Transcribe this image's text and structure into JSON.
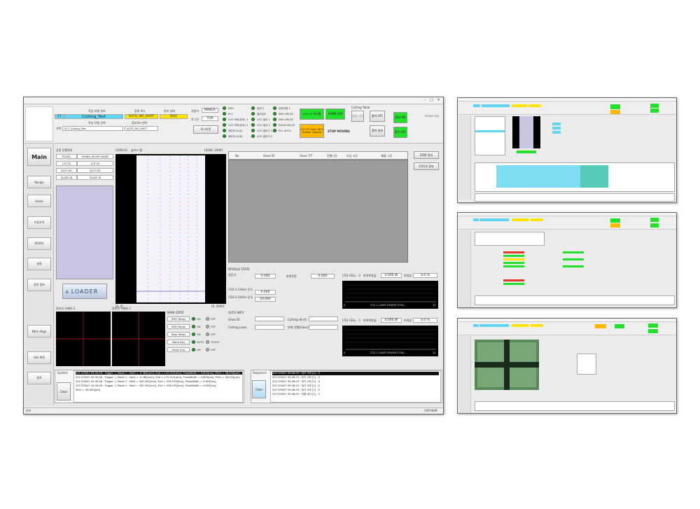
{
  "header": {
    "work_model_label": "작업 모델 정보",
    "model_no": "17",
    "model_name": "Cutting_Test",
    "equip_mode_label": "장비 모드",
    "equip_mode_value": "AUTO_NO_SHOT",
    "equip_state_label": "장비 상태",
    "equip_state_value": "IDLE",
    "model_select_label": "작업 모델 선택",
    "equip_mode_select_label": "장비모드선택",
    "model_select_prefix": "선택",
    "model_select_value": "017_Cutting_Test",
    "mode_select_value": "AUTO_NO_SHOT",
    "user_label": "사용자",
    "user_value": "MAKER",
    "login_label": "로그인",
    "login_value": "TOP",
    "logout_label": "로그아웃"
  },
  "interlocks_a": [
    "EMO",
    "PLC",
    "CO2 모터(장치) 1",
    "CO2 모터(장치) 2",
    "레이저 소(상)",
    "레이저 소(하)"
  ],
  "interlocks_b": [
    "집진기",
    "칠러온도",
    "CO2 칠러 1",
    "CO2 칠러 2",
    "CO2 칠러기 1",
    "CO2 칠러기 2"
  ],
  "interlocks_c": [
    "분위전원 1",
    "EMO RELAY",
    "EMO RELAY",
    "DOOR RELAY",
    "PLC AUTO"
  ],
  "status_buttons": {
    "co2_standby": "CO2 ST 대기중",
    "home_done": "HOME 완료",
    "co2_shutter": "CO2 ST Shot Off & Shutter Opened",
    "stop_moving": "STOP MOVING"
  },
  "cutting_table": {
    "title": "Cutting Table",
    "origin": "원점 시작",
    "absorb": "흡착 OFF",
    "absorb_done": "흡착 완료",
    "vacuum_on": "흡착 ON",
    "vacuum_off": "흡착 OFF"
  },
  "top_right": {
    "slider_label": "Shape log"
  },
  "sidebar": [
    "Main",
    "Recipe",
    "Vision",
    "수동조작",
    "I/O관리",
    "설정",
    "장비 정보",
    "Main Align",
    "대기 화면",
    "종료"
  ],
  "process_info": {
    "title": "공정 진행정보",
    "headers": [
      "MODEL",
      "MODEL RECIPE NAME"
    ],
    "rows": [
      [
        "LOT ID",
        "LOT ID"
      ],
      [
        "SLOT NO",
        "SLOT NO"
      ],
      [
        "GLASS ID",
        "GLASS ID"
      ]
    ]
  },
  "loader_label": "LOADER",
  "glass_map": {
    "title": "글라스 맵",
    "corner_tl": "[2000.0]",
    "corner_tr": "[2000, 2000]",
    "corner_bl": "[0, 0]",
    "corner_br": "[0, 2000]"
  },
  "table": {
    "headers": [
      "No",
      "Glass ID",
      "Glass T/T",
      "진행시간",
      "투입 시간",
      "배출 시간"
    ]
  },
  "side_buttons": [
    "STEP 정지",
    "CYCLE 정지"
  ],
  "module_state": {
    "title": "MODULE STATE",
    "l1": "집진기",
    "v1": "0.000",
    "l2": "분위전원",
    "v2": "0.000",
    "l3": "CO2-1 Chiller 온도",
    "v3": "0.000",
    "l4": "CO2-2 Chiller 온도",
    "v4": "20.000"
  },
  "co2_2": {
    "title": "CO2 CELL - 2",
    "label": "파워측정값",
    "value": "0.000 W",
    "label2": "보정값",
    "value2": "0.0 %",
    "axis_title": "CO2-2 LASER POWER(TOTAL)",
    "x0": "0",
    "x1": "10"
  },
  "co2_1": {
    "title": "CO2 CELL - 1",
    "label": "파워측정값",
    "value": "0.000 W",
    "label2": "보정값",
    "value2": "0.0 %",
    "axis_title": "CO2-1 LASER POWER(TOTAL)",
    "x0": "0",
    "x1": "10"
  },
  "auto_info": {
    "title": "AUTO INFO",
    "glass_id": "Glass ID",
    "cutting_recipe": "Cutting 레시피",
    "cutting_laser": "Cutting Laser",
    "current_speed": "현재 진행(Glass)"
  },
  "cameras": {
    "cam2": "얼라인 카메라 2",
    "cam1": "얼라인 카메라 1"
  },
  "main_state": {
    "title": "MAIN STATE",
    "rows": [
      {
        "label": "EMO Relay",
        "a": "ON",
        "b": "OFF"
      },
      {
        "label": "EMO Relay",
        "a": "ON",
        "b": "OFF"
      },
      {
        "label": "Door Relay",
        "a": "ON",
        "b": "OFF"
      },
      {
        "label": "Maint Key",
        "a": "AUTO",
        "b": "TEACH"
      },
      {
        "label": "Hand Grip",
        "a": "ON",
        "b": "OFF"
      }
    ]
  },
  "log": {
    "system_tab": "System",
    "sequence_tab": "Sequence",
    "clear": "Clear",
    "system_lines": [
      "2017/09/07 09:45:06 : Trigger : [ Mode 1 : Start = -0.382[mm], End = 170.512[mm], PulseWidth = 0.803[ms], Pitch = 36.000[μm]",
      "2017/09/07 09:45:06 : Trigger : [ Mode 1 : Start = -0.382[mm], End = 170.512[mm], PulseWidth = 0.803[ms], Pitch = 36.000[μm]",
      "2017/09/07 09:45:06 : Trigger : [ Mode 1 : Start = 342.002[mm], End = 536.239[mm], PulseWidth = 0.803[ms],",
      "2017/09/07 09:45:06 : Trigger : [ Mode 1 : Start = 342.002[mm], End = 536.239[mm], PulseWidth = 0.803[ms],",
      "Pitch = 36.000[μm]"
    ],
    "sequence_lines": [
      "2017/09/07 09:46:29 : 대기 시작 [1] - 0",
      "2017/09/07 09:46:29 : 대기 시작 [1] - 0",
      "2017/09/07 09:46:29 : 대기 시작 [1] - 0",
      "2017/09/07 09:46:29 : 대기 시작 [1] - 0",
      "2017/09/07 09:46:29 : 대기 시작 [1] - 0",
      "2017/09/07 09:46:29 : 연결 대기 [1] - 0"
    ]
  },
  "statusbar": {
    "left": "준비",
    "right": "CAP  NUM"
  },
  "colors": {
    "cyan": "#5fd5ef",
    "yellow": "#ffe400",
    "green": "#23e12a",
    "orange": "#ffb800"
  }
}
